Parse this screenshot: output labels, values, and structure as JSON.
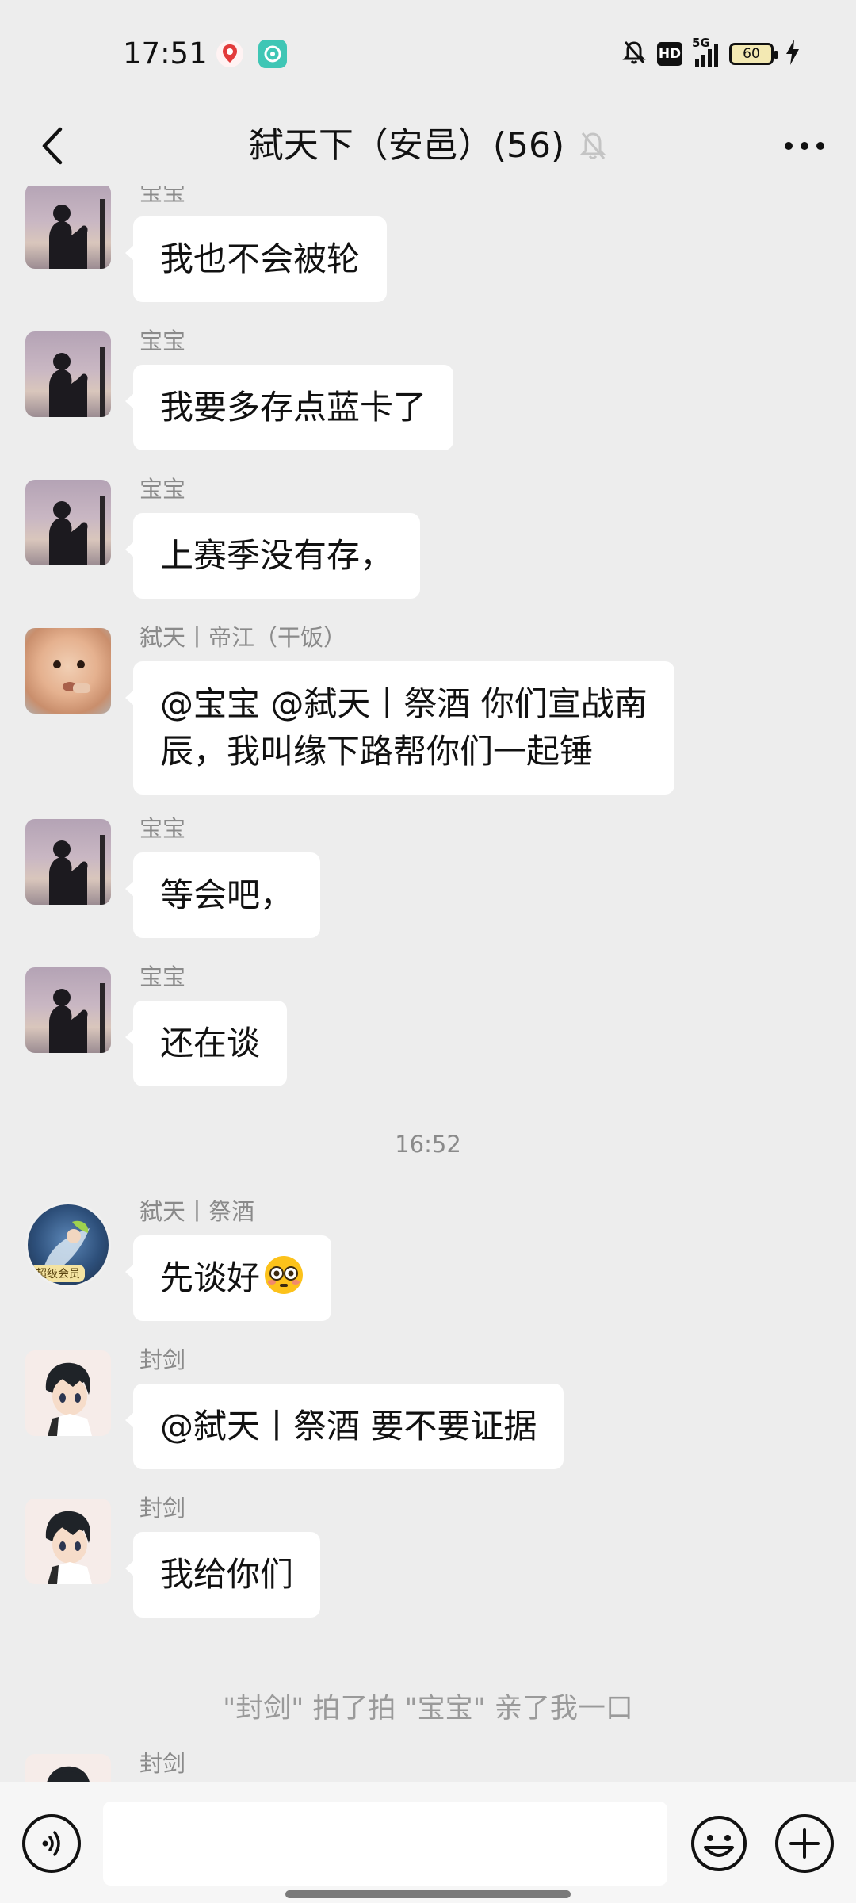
{
  "status_bar": {
    "time": "17:51",
    "network": "5G",
    "battery": "60",
    "icons": [
      "map-app-icon",
      "chat-app-icon",
      "mute-bell-icon",
      "hd-icon",
      "signal-icon",
      "battery-icon",
      "charging-icon"
    ]
  },
  "header": {
    "title": "弑天下（安邑）(56)",
    "icons": [
      "back-arrow-icon",
      "muted-bell-icon",
      "more-dots-icon"
    ]
  },
  "messages": [
    {
      "sender": "宝宝",
      "text": "我也不会被轮",
      "avatar": "silhouette-avatar"
    },
    {
      "sender": "宝宝",
      "text": "我要多存点蓝卡了",
      "avatar": "silhouette-avatar"
    },
    {
      "sender": "宝宝",
      "text": "上赛季没有存，",
      "avatar": "silhouette-avatar"
    },
    {
      "sender": "弑天丨帝江（干饭）",
      "line1": "@宝宝  @弑天丨祭酒  你们宣战南",
      "line2": "辰，我叫缘下路帮你们一起锤",
      "avatar": "baby-avatar"
    },
    {
      "sender": "宝宝",
      "text": "等会吧，",
      "avatar": "silhouette-avatar"
    },
    {
      "sender": "宝宝",
      "text": "还在谈",
      "avatar": "silhouette-avatar"
    },
    {
      "timestamp": "16:52"
    },
    {
      "sender": "弑天丨祭酒",
      "text": "先谈好",
      "emoji": "flushed-face-icon",
      "badge": "超级会员",
      "avatar": "game-character-avatar"
    },
    {
      "sender": "封剑",
      "text": "@弑天丨祭酒  要不要证据",
      "avatar": "anime-boy-avatar"
    },
    {
      "sender": "封剑",
      "text": "我给你们",
      "avatar": "anime-boy-avatar"
    },
    {
      "system": "\"封剑\" 拍了拍 \"宝宝\" 亲了我一口"
    },
    {
      "sender": "封剑",
      "avatar": "anime-boy-avatar"
    }
  ],
  "input_bar": {
    "placeholder": "",
    "icons": [
      "voice-icon",
      "emoji-icon",
      "plus-icon"
    ]
  },
  "colors": {
    "background": "#ededed",
    "bubble": "#ffffff",
    "sender_name": "#8a8a8a",
    "battery_fill": "#f3e9b3"
  }
}
